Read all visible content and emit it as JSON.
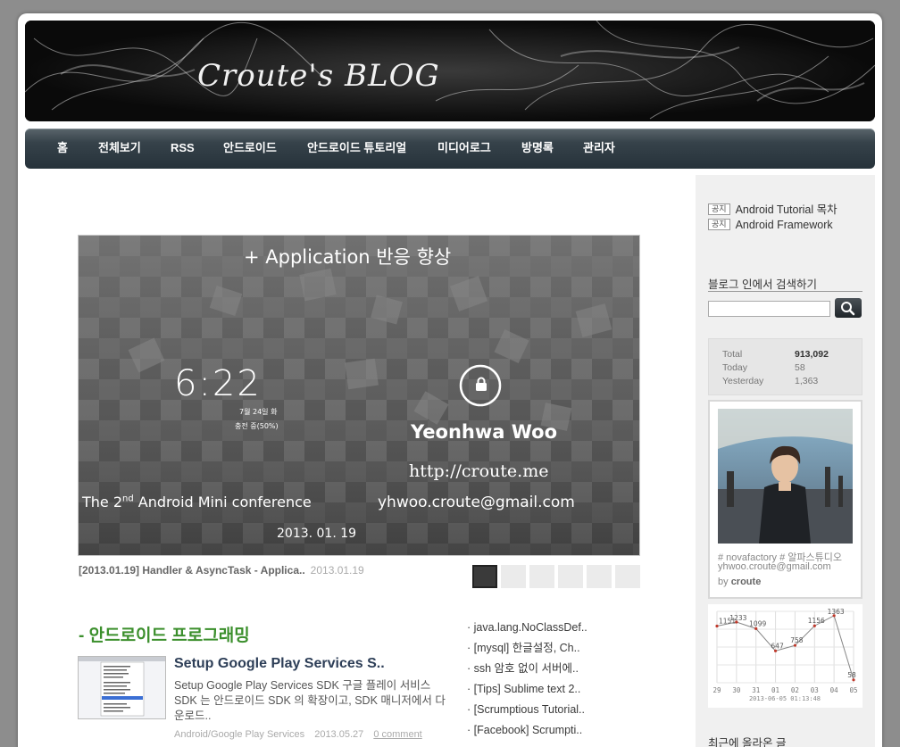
{
  "blog": {
    "title": "Croute's BLOG"
  },
  "nav": {
    "items": [
      "홈",
      "전체보기",
      "RSS",
      "안드로이드",
      "안드로이드 튜토리얼",
      "미디어로그",
      "방명록",
      "관리자"
    ]
  },
  "slide": {
    "headline": "+ Application 반응 향상",
    "clock": "6:22",
    "date_text": "7월 24일 화",
    "charging_text": "충전 중(50%)",
    "name": "Yeonhwa Woo",
    "url": "http://croute.me",
    "email": "yhwoo.croute@gmail.com",
    "conf_pre": "The 2",
    "conf_sup": "nd",
    "conf_post": " Android Mini conference",
    "conf_date": "2013. 01. 19",
    "caption_title": "[2013.01.19] Handler & AsyncTask - Applica..",
    "caption_date": "2013.01.19"
  },
  "section": {
    "title": "- 안드로이드 프로그래밍"
  },
  "post": {
    "title": "Setup Google Play Services S..",
    "excerpt": "Setup Google Play Services SDK 구글 플레이 서비스 SDK 는 안드로이드 SDK 의 확장이고, SDK 매니저에서 다운로드..",
    "category": "Android/Google Play Services",
    "date": "2013.05.27",
    "comments": "0 comment"
  },
  "recent_list": [
    "· java.lang.NoClassDef..",
    "· [mysql] 한글설정, Ch..",
    "· ssh 암호 없이 서버에..",
    "· [Tips] Sublime text 2..",
    "· [Scrumptious Tutorial..",
    "· [Facebook] Scrumpti.."
  ],
  "sidebar": {
    "notices": [
      {
        "tag": "공지",
        "label": "Android Tutorial 목차"
      },
      {
        "tag": "공지",
        "label": "Android Framework"
      }
    ],
    "search_heading": "블로그 인에서 검색하기",
    "search_placeholder": "",
    "counter": [
      {
        "label": "Total",
        "value": "913,092"
      },
      {
        "label": "Today",
        "value": "58"
      },
      {
        "label": "Yesterday",
        "value": "1,363"
      }
    ],
    "profile": {
      "line1": "# novafactory # 알파스튜디오",
      "line2": "yhwoo.croute@gmail.com",
      "by_prefix": "by ",
      "by_name": "croute"
    },
    "recent_heading": "최근에 올라온 글"
  },
  "chart_data": {
    "type": "line",
    "categories": [
      "29",
      "30",
      "31",
      "01",
      "02",
      "03",
      "04",
      "05"
    ],
    "values": [
      1151,
      1233,
      1099,
      647,
      758,
      1156,
      1363,
      58
    ],
    "ylim": [
      0,
      1450
    ],
    "footer": "2013-06-05 01:13:48"
  },
  "colors": {
    "section_title": "#3b8f2c",
    "post_title": "#2d3e57",
    "nav_bg": "#2b373f"
  },
  "icons": {
    "search": "search-icon",
    "lock": "lock-icon"
  }
}
